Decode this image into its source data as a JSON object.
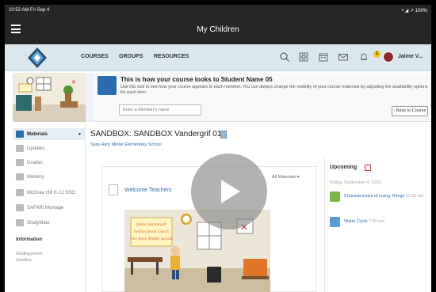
{
  "status_bar": {
    "time_date": "10:52 AM  Fri Sep 4",
    "right": "• ◢ ↗ 100%"
  },
  "app": {
    "title": "My Children"
  },
  "nav": {
    "links": [
      "COURSES",
      "GROUPS",
      "RESOURCES"
    ],
    "notification_count": "1",
    "user_name": "Jaime V...",
    "icons": [
      "search-icon",
      "grid-icon",
      "calendar-icon",
      "mail-icon",
      "bell-icon"
    ]
  },
  "banner": {
    "title": "This is how your course looks to Student Name 05",
    "description": "Use this tool to see how your course appears to each member. You can always change the visibility of your course materials by adjusting the availability options for each item.",
    "member_placeholder": "Enter a Member's name",
    "back_button": "‹ Back to Course"
  },
  "sidebar": {
    "items": [
      {
        "label": "Materials",
        "icon": "folder-icon"
      },
      {
        "label": "Updates",
        "icon": "updates-icon"
      },
      {
        "label": "Grades",
        "icon": "grades-icon"
      },
      {
        "label": "Mastery",
        "icon": "mastery-icon"
      },
      {
        "label": "McGraw Hill K-12 SSO",
        "icon": "mcgraw-icon"
      },
      {
        "label": "SAFARI Montage",
        "icon": "safari-icon"
      },
      {
        "label": "StudyMate",
        "icon": "studymate-icon"
      }
    ],
    "information_heading": "Information",
    "grading_label": "Grading period",
    "grading_value": "Sandbox"
  },
  "main": {
    "course_title": "SANDBOX: SANDBOX Vandergrif 01",
    "school": "Sara Harp Minter Elementary School",
    "all_materials": "All Materials ▾",
    "welcome": "Welcome Teachers",
    "poster_lines": [
      "Jaime Vandergrif",
      "Instructional Coach",
      "Fort Rock Middle School"
    ]
  },
  "upcoming": {
    "title": "Upcoming",
    "date": "Friday, September 4, 2020",
    "items": [
      {
        "title": "Characteristics of Living Things",
        "time": "11:00 am",
        "color": "#7cb342"
      },
      {
        "title": "Water Cycle",
        "time": "7:59 pm",
        "color": "#5b9bd5"
      }
    ]
  },
  "colors": {
    "header": "#262626",
    "nav_bg": "#dbe7ef",
    "link": "#2b6cb0"
  }
}
